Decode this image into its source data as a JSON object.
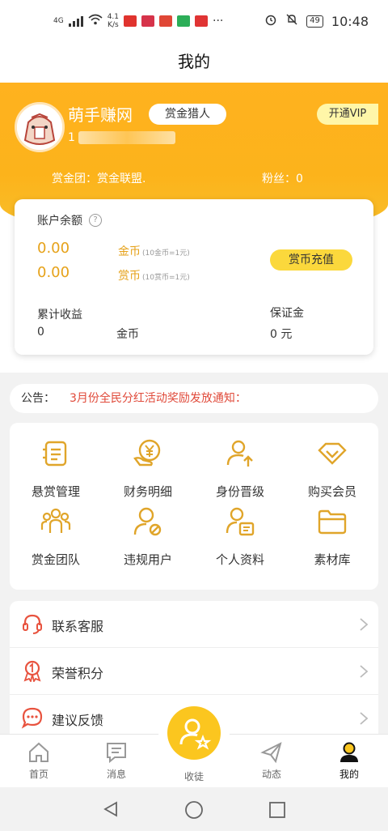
{
  "status_bar": {
    "network": "4G",
    "speed": "4.1\nK/s",
    "battery": "49",
    "time": "10:48"
  },
  "title": "我的",
  "profile": {
    "name": "萌手赚网",
    "role_badge": "赏金猎人",
    "id_prefix": "1",
    "vip_button": "开通VIP",
    "team_line": "赏金团：赏金联盟.",
    "fans_line": "粉丝：0"
  },
  "account": {
    "title": "账户余额",
    "gold_amount": "0.00",
    "gold_unit": "金币",
    "gold_rate": "(10金币=1元)",
    "reward_amount": "0.00",
    "reward_unit": "赏币",
    "reward_rate": "(10赏币=1元)",
    "recharge_button": "赏币充值",
    "total_income_label": "累计收益",
    "total_income_value": "0",
    "total_income_unit": "金币",
    "deposit_label": "保证金",
    "deposit_value": "0 元"
  },
  "notice": {
    "label": "公告：",
    "text": "3月份全民分红活动奖励发放通知："
  },
  "grid": [
    {
      "label": "悬赏管理",
      "icon": "task-list-icon"
    },
    {
      "label": "财务明细",
      "icon": "yuan-coin-icon"
    },
    {
      "label": "身份晋级",
      "icon": "user-upgrade-icon"
    },
    {
      "label": "购买会员",
      "icon": "diamond-icon"
    },
    {
      "label": "赏金团队",
      "icon": "team-icon"
    },
    {
      "label": "违规用户",
      "icon": "user-blocked-icon"
    },
    {
      "label": "个人资料",
      "icon": "profile-card-icon"
    },
    {
      "label": "素材库",
      "icon": "folder-icon"
    }
  ],
  "menu": [
    {
      "label": "联系客服",
      "icon": "headset-icon"
    },
    {
      "label": "荣誉积分",
      "icon": "medal-icon"
    },
    {
      "label": "建议反馈",
      "icon": "chat-bubble-icon"
    }
  ],
  "nav": [
    {
      "label": "首页",
      "icon": "home-icon"
    },
    {
      "label": "消息",
      "icon": "message-icon"
    },
    {
      "label": "收徒",
      "icon": "recruit-icon"
    },
    {
      "label": "动态",
      "icon": "paper-plane-icon"
    },
    {
      "label": "我的",
      "icon": "person-icon"
    }
  ],
  "colors": {
    "brand_orange": "#ffb21f",
    "gold_text": "#e6a21a",
    "notice_red": "#e04a3a",
    "recharge_yellow": "#fbd83c",
    "icon_gold": "#e0a52a",
    "menu_red": "#e8533f"
  }
}
